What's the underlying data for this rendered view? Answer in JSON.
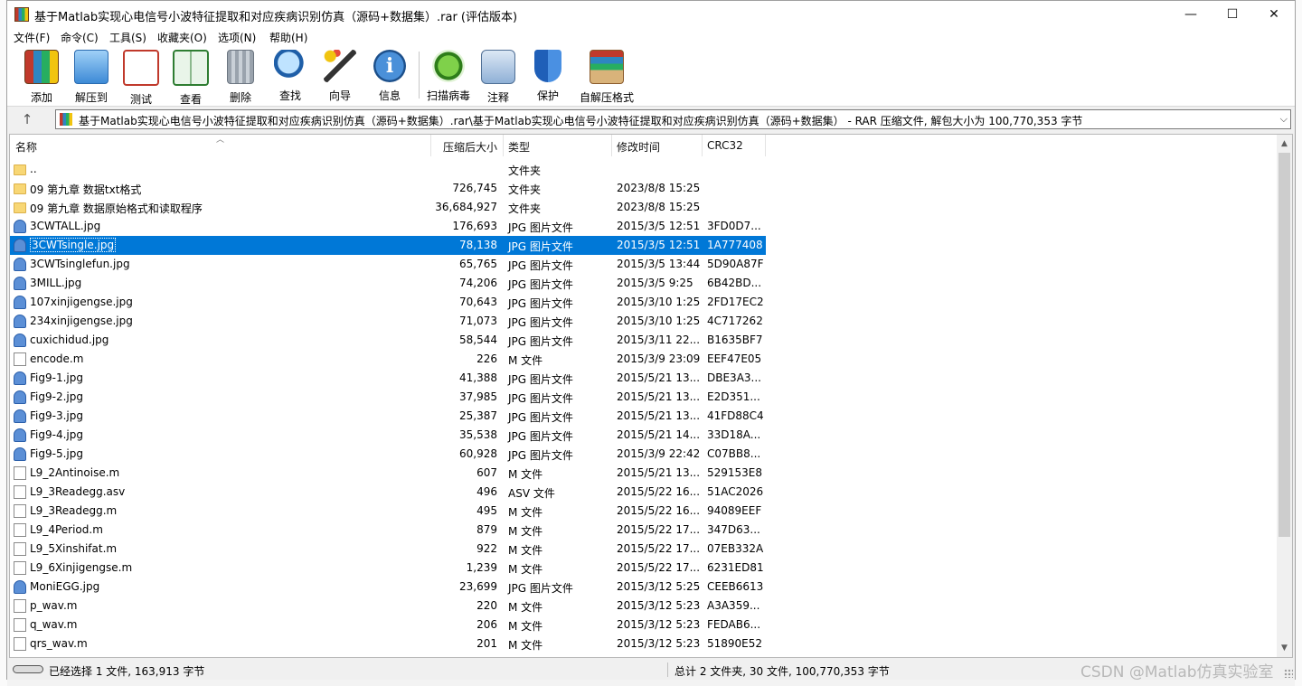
{
  "window": {
    "title": "基于Matlab实现心电信号小波特征提取和对应疾病识别仿真（源码+数据集）.rar (评估版本)",
    "minimize": "—",
    "maximize": "☐",
    "close": "✕"
  },
  "menu": [
    "文件(F)",
    "命令(C)",
    "工具(S)",
    "收藏夹(O)",
    "选项(N)",
    "帮助(H)"
  ],
  "toolbar": [
    {
      "label": "添加",
      "icon": "add-archive-icon"
    },
    {
      "label": "解压到",
      "icon": "extract-to-icon"
    },
    {
      "label": "测试",
      "icon": "test-icon"
    },
    {
      "label": "查看",
      "icon": "view-icon"
    },
    {
      "label": "删除",
      "icon": "delete-icon"
    },
    {
      "label": "查找",
      "icon": "find-icon"
    },
    {
      "label": "向导",
      "icon": "wizard-icon"
    },
    {
      "label": "信息",
      "icon": "info-icon"
    },
    {
      "label": "扫描病毒",
      "icon": "virus-scan-icon"
    },
    {
      "label": "注释",
      "icon": "comment-icon"
    },
    {
      "label": "保护",
      "icon": "protect-icon"
    },
    {
      "label": "自解压格式",
      "icon": "sfx-icon"
    }
  ],
  "address": {
    "up": "↑",
    "path": "基于Matlab实现心电信号小波特征提取和对应疾病识别仿真（源码+数据集）.rar\\基于Matlab实现心电信号小波特征提取和对应疾病识别仿真（源码+数据集） - RAR 压缩文件, 解包大小为 100,770,353 字节",
    "dropdown": "⌵"
  },
  "columns": {
    "name": "名称",
    "packed": "压缩后大小",
    "type": "类型",
    "modified": "修改时间",
    "crc": "CRC32"
  },
  "files": [
    {
      "name": "..",
      "size": "",
      "type": "文件夹",
      "time": "",
      "crc": "",
      "kind": "folder"
    },
    {
      "name": "09 第九章 数据txt格式",
      "size": "726,745",
      "type": "文件夹",
      "time": "2023/8/8 15:25",
      "crc": "",
      "kind": "folder"
    },
    {
      "name": "09 第九章 数据原始格式和读取程序",
      "size": "36,684,927",
      "type": "文件夹",
      "time": "2023/8/8 15:25",
      "crc": "",
      "kind": "folder"
    },
    {
      "name": "3CWTALL.jpg",
      "size": "176,693",
      "type": "JPG 图片文件",
      "time": "2015/3/5 12:51",
      "crc": "3FD0D7...",
      "kind": "jpg"
    },
    {
      "name": "3CWTsingle.jpg",
      "size": "78,138",
      "type": "JPG 图片文件",
      "time": "2015/3/5 12:51",
      "crc": "1A777408",
      "kind": "jpg",
      "selected": true
    },
    {
      "name": "3CWTsinglefun.jpg",
      "size": "65,765",
      "type": "JPG 图片文件",
      "time": "2015/3/5 13:44",
      "crc": "5D90A87F",
      "kind": "jpg"
    },
    {
      "name": "3MILL.jpg",
      "size": "74,206",
      "type": "JPG 图片文件",
      "time": "2015/3/5 9:25",
      "crc": "6B42BD...",
      "kind": "jpg"
    },
    {
      "name": "107xinjigengse.jpg",
      "size": "70,643",
      "type": "JPG 图片文件",
      "time": "2015/3/10 1:25",
      "crc": "2FD17EC2",
      "kind": "jpg"
    },
    {
      "name": "234xinjigengse.jpg",
      "size": "71,073",
      "type": "JPG 图片文件",
      "time": "2015/3/10 1:25",
      "crc": "4C717262",
      "kind": "jpg"
    },
    {
      "name": "cuxichidud.jpg",
      "size": "58,544",
      "type": "JPG 图片文件",
      "time": "2015/3/11 22...",
      "crc": "B1635BF7",
      "kind": "jpg"
    },
    {
      "name": "encode.m",
      "size": "226",
      "type": "M 文件",
      "time": "2015/3/9 23:09",
      "crc": "EEF47E05",
      "kind": "file"
    },
    {
      "name": "Fig9-1.jpg",
      "size": "41,388",
      "type": "JPG 图片文件",
      "time": "2015/5/21 13...",
      "crc": "DBE3A3...",
      "kind": "jpg"
    },
    {
      "name": "Fig9-2.jpg",
      "size": "37,985",
      "type": "JPG 图片文件",
      "time": "2015/5/21 13...",
      "crc": "E2D351...",
      "kind": "jpg"
    },
    {
      "name": "Fig9-3.jpg",
      "size": "25,387",
      "type": "JPG 图片文件",
      "time": "2015/5/21 13...",
      "crc": "41FD88C4",
      "kind": "jpg"
    },
    {
      "name": "Fig9-4.jpg",
      "size": "35,538",
      "type": "JPG 图片文件",
      "time": "2015/5/21 14...",
      "crc": "33D18A...",
      "kind": "jpg"
    },
    {
      "name": "Fig9-5.jpg",
      "size": "60,928",
      "type": "JPG 图片文件",
      "time": "2015/3/9 22:42",
      "crc": "C07BB8...",
      "kind": "jpg"
    },
    {
      "name": "L9_2Antinoise.m",
      "size": "607",
      "type": "M 文件",
      "time": "2015/5/21 13...",
      "crc": "529153E8",
      "kind": "file"
    },
    {
      "name": "L9_3Readegg.asv",
      "size": "496",
      "type": "ASV 文件",
      "time": "2015/5/22 16...",
      "crc": "51AC2026",
      "kind": "file"
    },
    {
      "name": "L9_3Readegg.m",
      "size": "495",
      "type": "M 文件",
      "time": "2015/5/22 16...",
      "crc": "94089EEF",
      "kind": "file"
    },
    {
      "name": "L9_4Period.m",
      "size": "879",
      "type": "M 文件",
      "time": "2015/5/22 17...",
      "crc": "347D63...",
      "kind": "file"
    },
    {
      "name": "L9_5Xinshifat.m",
      "size": "922",
      "type": "M 文件",
      "time": "2015/5/22 17...",
      "crc": "07EB332A",
      "kind": "file"
    },
    {
      "name": "L9_6Xinjigengse.m",
      "size": "1,239",
      "type": "M 文件",
      "time": "2015/5/22 17...",
      "crc": "6231ED81",
      "kind": "file"
    },
    {
      "name": "MoniEGG.jpg",
      "size": "23,699",
      "type": "JPG 图片文件",
      "time": "2015/3/12 5:25",
      "crc": "CEEB6613",
      "kind": "jpg"
    },
    {
      "name": "p_wav.m",
      "size": "220",
      "type": "M 文件",
      "time": "2015/3/12 5:23",
      "crc": "A3A359...",
      "kind": "file"
    },
    {
      "name": "q_wav.m",
      "size": "206",
      "type": "M 文件",
      "time": "2015/3/12 5:23",
      "crc": "FEDAB6...",
      "kind": "file"
    },
    {
      "name": "qrs_wav.m",
      "size": "201",
      "type": "M 文件",
      "time": "2015/3/12 5:23",
      "crc": "51890E52",
      "kind": "file"
    }
  ],
  "status": {
    "left": "已经选择 1 文件, 163,913 字节",
    "right": "总计 2 文件夹, 30 文件, 100,770,353 字节"
  },
  "watermark": "CSDN @Matlab仿真实验室",
  "colors": {
    "selection": "#0078d7",
    "folder": "#f8d775",
    "jpg_icon": "#5b8fd6"
  }
}
